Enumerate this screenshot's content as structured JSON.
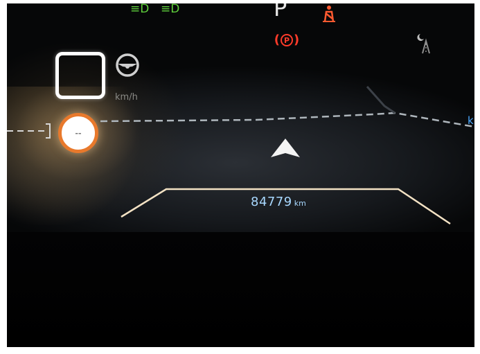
{
  "indicators": {
    "gear": "P",
    "parking_brake": "P",
    "speed_unit": "km/h",
    "speed_limit": "--",
    "right_unit": "k",
    "icons": [
      "low-beam-icon",
      "high-beam-icon",
      "seatbelt-warning-icon",
      "parking-brake-icon",
      "night-mode-icon",
      "lane-assist-steering-icon",
      "navigation-arrow-icon"
    ]
  },
  "odometer": {
    "value": "84779",
    "unit": "km"
  },
  "colors": {
    "indicator_green": "#5fd03c",
    "warning_red": "#ff3b2a",
    "speed_limit_ring": "#e8792c",
    "odometer_blue": "#a8d8ff",
    "unit_blue": "#4aa8ff"
  }
}
